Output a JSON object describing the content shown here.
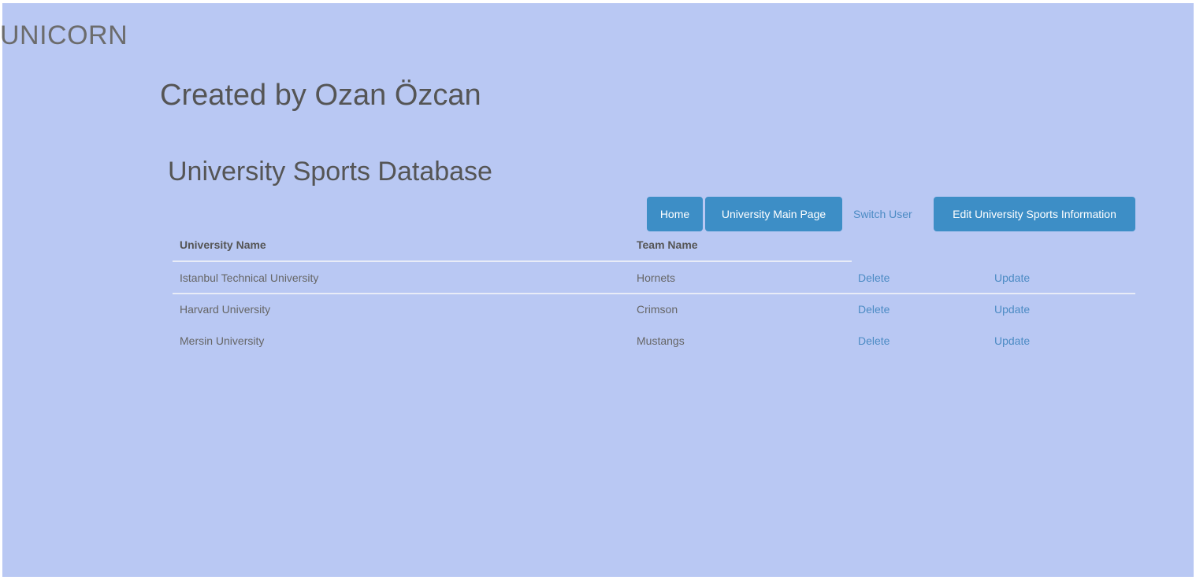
{
  "brand": "UNICORN",
  "creator": "Created by Ozan Özcan",
  "page_title": "University Sports Database",
  "nav": {
    "home": "Home",
    "university_main_page": "University Main Page",
    "switch_user": "Switch User",
    "edit_sports_info": "Edit University Sports Information"
  },
  "table": {
    "headers": [
      "University Name",
      "Team Name"
    ],
    "rows": [
      {
        "university": "Istanbul Technical University",
        "team": "Hornets",
        "delete": "Delete",
        "update": "Update"
      },
      {
        "university": "Harvard University",
        "team": "Crimson",
        "delete": "Delete",
        "update": "Update"
      },
      {
        "university": "Mersin University",
        "team": "Mustangs",
        "delete": "Delete",
        "update": "Update"
      }
    ]
  },
  "colors": {
    "background": "#b9c8f3",
    "button": "#3d8ec6",
    "link": "#4c8bc4"
  }
}
